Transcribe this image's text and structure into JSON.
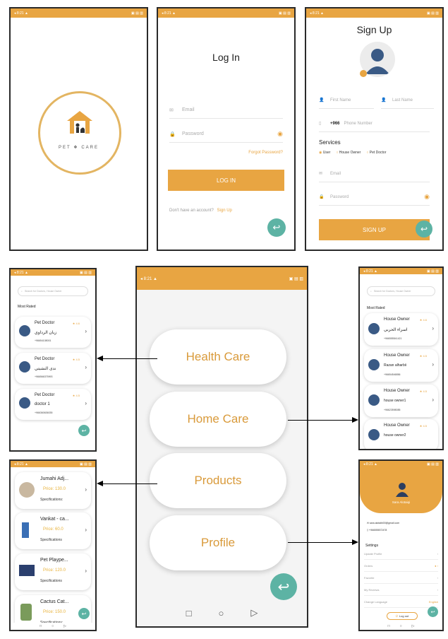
{
  "status_bar": {
    "left": "◂ 8:21 ▲",
    "right": "▣ ▤ ▥"
  },
  "splash": {
    "brand_left": "PET",
    "brand_right": "CARE"
  },
  "login": {
    "title": "Log In",
    "email_placeholder": "Email",
    "password_placeholder": "Password",
    "forgot": "Forgot Password?",
    "button": "LOG IN",
    "no_account": "Don't have an account?",
    "signup_link": "Sign Up"
  },
  "signup": {
    "title": "Sign Up",
    "first_name": "First Name",
    "last_name": "Last Name",
    "country_code": "+966",
    "phone_placeholder": "Phone Number",
    "services_label": "Services",
    "roles": [
      "User",
      "House Owner",
      "Pet Doctor"
    ],
    "email_placeholder": "Email",
    "password_placeholder": "Password",
    "button": "SIGN UP"
  },
  "doctors": {
    "search": "Search for Doctors, House Owner",
    "section": "Most Rated",
    "items": [
      {
        "role": "Pet Doctor",
        "rating": "4.6",
        "name": "زيان الرداوي",
        "phone": "+96654108001"
      },
      {
        "role": "Pet Doctor",
        "rating": "4.5",
        "name": "ندى النشيتي",
        "phone": "+966566375993"
      },
      {
        "role": "Pet Doctor",
        "rating": "4.5",
        "name": "doctor 1",
        "phone": "+966360636035"
      }
    ]
  },
  "menu": {
    "items": [
      "Health Care",
      "Home Care",
      "Products",
      "Profile"
    ]
  },
  "owners": {
    "search": "Search for Doctors, House Owner",
    "section": "Most Rated",
    "items": [
      {
        "role": "House Owner",
        "rating": "4.6",
        "name": "اسراء الحربي",
        "phone": "+966555541421"
      },
      {
        "role": "House Owner",
        "rating": "4.5",
        "name": "Razan alharbii",
        "phone": "+96654546856"
      },
      {
        "role": "House Owner",
        "rating": "4.5",
        "name": "house owner1",
        "phone": "+96623598085"
      },
      {
        "role": "House Owner",
        "rating": "4.5",
        "name": "house owner2",
        "phone": ""
      }
    ]
  },
  "products": {
    "items": [
      {
        "name": "Jumahi Adj...",
        "price": "Price: 130.0",
        "spec": "Specifications:"
      },
      {
        "name": "Vankat - ca...",
        "price": "Price: 60.0",
        "spec": "Specifications"
      },
      {
        "name": "Pet Plaype...",
        "price": "Price: 120.0",
        "spec": "Specifications"
      },
      {
        "name": "Cactus Cat...",
        "price": "Price: 150.0",
        "spec": "Specifications:"
      }
    ]
  },
  "profile": {
    "name": "Sara Alotaiqi",
    "email": "sara.alotaibi00@gmail.com",
    "phone": "+966555572478",
    "settings_label": "Settings",
    "rows": [
      "Update Profile",
      "Orders",
      "Favorite",
      "My Reviews",
      "Change Language"
    ],
    "language_value": "English",
    "logout": "Log out"
  },
  "colors": {
    "accent": "#e8a542",
    "fab": "#5db3a4",
    "price": "#e8b23a"
  }
}
